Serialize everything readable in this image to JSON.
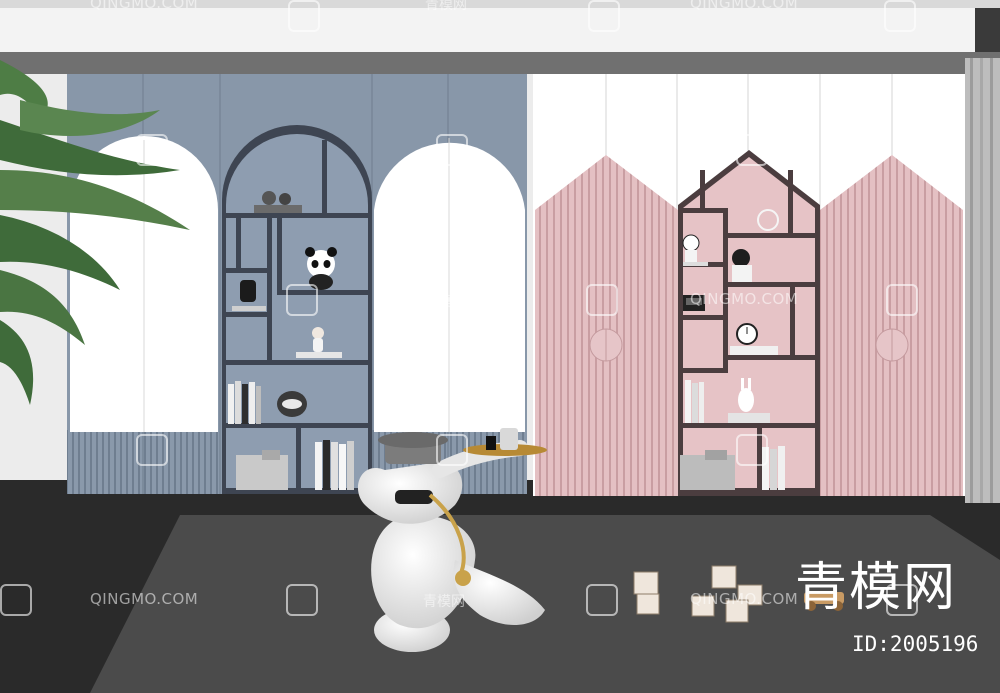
{
  "watermarks": {
    "site_en": "QINGMO.COM",
    "site_cn": "青模网"
  },
  "brand": {
    "logo_text": "青模网",
    "id_label": "ID:2005196"
  },
  "colors": {
    "ceiling": "#f4f4f4",
    "wall": "#e9e9e9",
    "floor": "#2b2b2b",
    "rug": "#4a4a4a",
    "blue_cabinet": "#8796a8",
    "blue_shelf_dark": "#3d4450",
    "pink_cabinet": "#e2bcbf",
    "pink_shelf_dark": "#4b3c3e",
    "white_door": "#ffffff"
  }
}
